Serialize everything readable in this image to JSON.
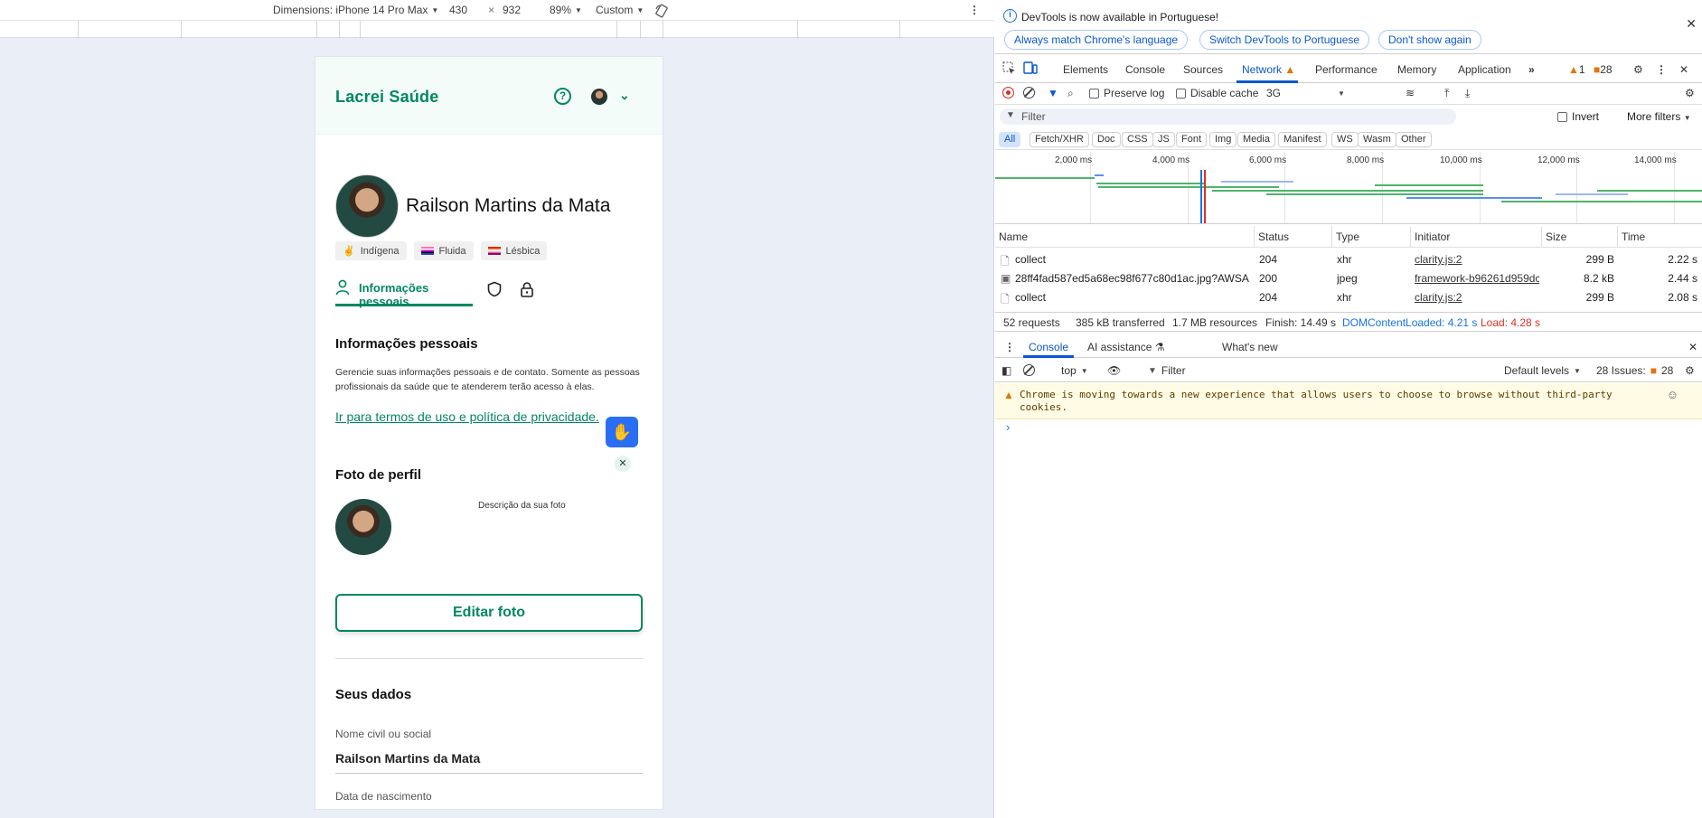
{
  "emulator": {
    "dimensions_label": "Dimensions: iPhone 14 Pro Max",
    "width": "430",
    "times": "×",
    "height": "932",
    "zoom": "89%",
    "throttle": "Custom"
  },
  "app": {
    "brand": "Lacrei Saúde",
    "help_glyph": "?",
    "user_name": "Railson Martins da Mata",
    "chips": [
      {
        "label": "Indígena",
        "icon": "peace-hand-icon"
      },
      {
        "label": "Fluida",
        "icon": "genderfluid-flag-icon"
      },
      {
        "label": "Lésbica",
        "icon": "lesbian-flag-icon"
      }
    ],
    "tab_personal": "Informações pessoais",
    "section_personal_title": "Informações pessoais",
    "section_personal_desc": "Gerencie suas informações pessoais e de contato. Somente as pessoas profissionais da saúde que te atenderem terão acesso à elas.",
    "terms_link": "Ir para termos de uso e política de privacidade.",
    "photo_title": "Foto de perfil",
    "photo_desc": "Descrição da sua foto",
    "edit_photo": "Editar foto",
    "data_title": "Seus dados",
    "field_name_label": "Nome civil ou social",
    "field_name_value": "Railson Martins da Mata",
    "field_birth_label": "Data de nascimento"
  },
  "devtools": {
    "info_message": "DevTools is now available in Portuguese!",
    "info_buttons": [
      "Always match Chrome's language",
      "Switch DevTools to Portuguese",
      "Don't show again"
    ],
    "tabs": [
      "Elements",
      "Console",
      "Sources",
      "Network",
      "Performance",
      "Memory",
      "Application"
    ],
    "active_tab": "Network",
    "warnings_count": "1",
    "issues_count": "28",
    "preserve_log": "Preserve log",
    "disable_cache": "Disable cache",
    "throttling": "3G",
    "filter_placeholder": "Filter",
    "invert": "Invert",
    "more_filters": "More filters",
    "type_filters": [
      "All",
      "Fetch/XHR",
      "Doc",
      "CSS",
      "JS",
      "Font",
      "Img",
      "Media",
      "Manifest",
      "WS",
      "Wasm",
      "Other"
    ],
    "timeline_ticks": [
      "2,000 ms",
      "4,000 ms",
      "6,000 ms",
      "8,000 ms",
      "10,000 ms",
      "12,000 ms",
      "14,000 ms"
    ],
    "columns": [
      "Name",
      "Status",
      "Type",
      "Initiator",
      "Size",
      "Time"
    ],
    "rows": [
      {
        "name": "collect",
        "status": "204",
        "type": "xhr",
        "initiator": "clarity.js:2",
        "size": "299 B",
        "time": "2.22 s"
      },
      {
        "name": "28ff4fad587ed5a68ec98f677c80d1ac.jpg?AWSA...",
        "status": "200",
        "type": "jpeg",
        "initiator": "framework-b96261d959dc",
        "size": "8.2 kB",
        "time": "2.44 s"
      },
      {
        "name": "collect",
        "status": "204",
        "type": "xhr",
        "initiator": "clarity.js:2",
        "size": "299 B",
        "time": "2.08 s"
      }
    ],
    "summary": {
      "requests": "52 requests",
      "transferred": "385 kB transferred",
      "resources": "1.7 MB resources",
      "finish": "Finish: 14.49 s",
      "dcl": "DOMContentLoaded: 4.21 s",
      "load": "Load: 4.28 s"
    },
    "drawer_tabs": [
      "Console",
      "AI assistance",
      "What's new"
    ],
    "console_context": "top",
    "console_filter": "Filter",
    "default_levels": "Default levels",
    "console_issues": "28 Issues:",
    "console_issues_count": "28",
    "warning_text": "Chrome is moving towards a new experience that allows users to choose to browse without third-party cookies.",
    "prompt": "›",
    "colors": {
      "accent": "#0b57d0",
      "brand": "#018762",
      "load": "#d93025"
    }
  }
}
